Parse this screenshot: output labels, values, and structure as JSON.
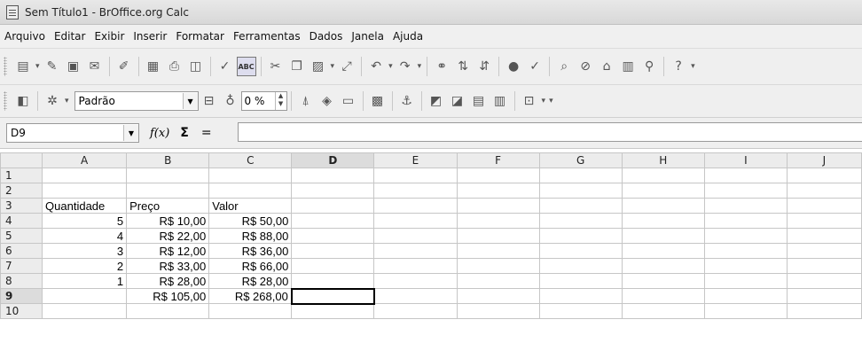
{
  "window": {
    "title": "Sem Título1 - BrOffice.org Calc"
  },
  "menu": [
    "Arquivo",
    "Editar",
    "Exibir",
    "Inserir",
    "Formatar",
    "Ferramentas",
    "Dados",
    "Janela",
    "Ajuda"
  ],
  "toolbar_icons": [
    "new-document",
    "open",
    "save",
    "email",
    "edit-file",
    "export-pdf",
    "print",
    "page-preview",
    "spellcheck",
    "autospellcheck",
    "cut",
    "copy",
    "paste",
    "clone-format",
    "undo",
    "redo",
    "hyperlink",
    "sort-ascending",
    "sort-descending",
    "chart",
    "draw-functions",
    "find-replace",
    "navigator",
    "gallery",
    "datasource",
    "zoom",
    "help"
  ],
  "format_bar": {
    "style": "Padrão",
    "zoom": "0 %"
  },
  "name_box": "D9",
  "formula": "",
  "formula_icons": [
    "function-wizard",
    "sum",
    "equals"
  ],
  "columns": [
    "A",
    "B",
    "C",
    "D",
    "E",
    "F",
    "G",
    "H",
    "I",
    "J"
  ],
  "active_column": "D",
  "active_row": "9",
  "rows": [
    {
      "n": "1",
      "cells": [
        "",
        "",
        ""
      ]
    },
    {
      "n": "2",
      "cells": [
        "",
        "",
        ""
      ]
    },
    {
      "n": "3",
      "cells": [
        "Quantidade",
        "Preço",
        "Valor"
      ]
    },
    {
      "n": "4",
      "cells": [
        "5",
        "R$ 10,00",
        "R$ 50,00"
      ]
    },
    {
      "n": "5",
      "cells": [
        "4",
        "R$ 22,00",
        "R$ 88,00"
      ]
    },
    {
      "n": "6",
      "cells": [
        "3",
        "R$ 12,00",
        "R$ 36,00"
      ]
    },
    {
      "n": "7",
      "cells": [
        "2",
        "R$ 33,00",
        "R$ 66,00"
      ]
    },
    {
      "n": "8",
      "cells": [
        "1",
        "R$ 28,00",
        "R$ 28,00"
      ]
    },
    {
      "n": "9",
      "cells": [
        "",
        "R$ 105,00",
        "R$ 268,00"
      ]
    },
    {
      "n": "10",
      "cells": [
        "",
        "",
        ""
      ]
    }
  ]
}
